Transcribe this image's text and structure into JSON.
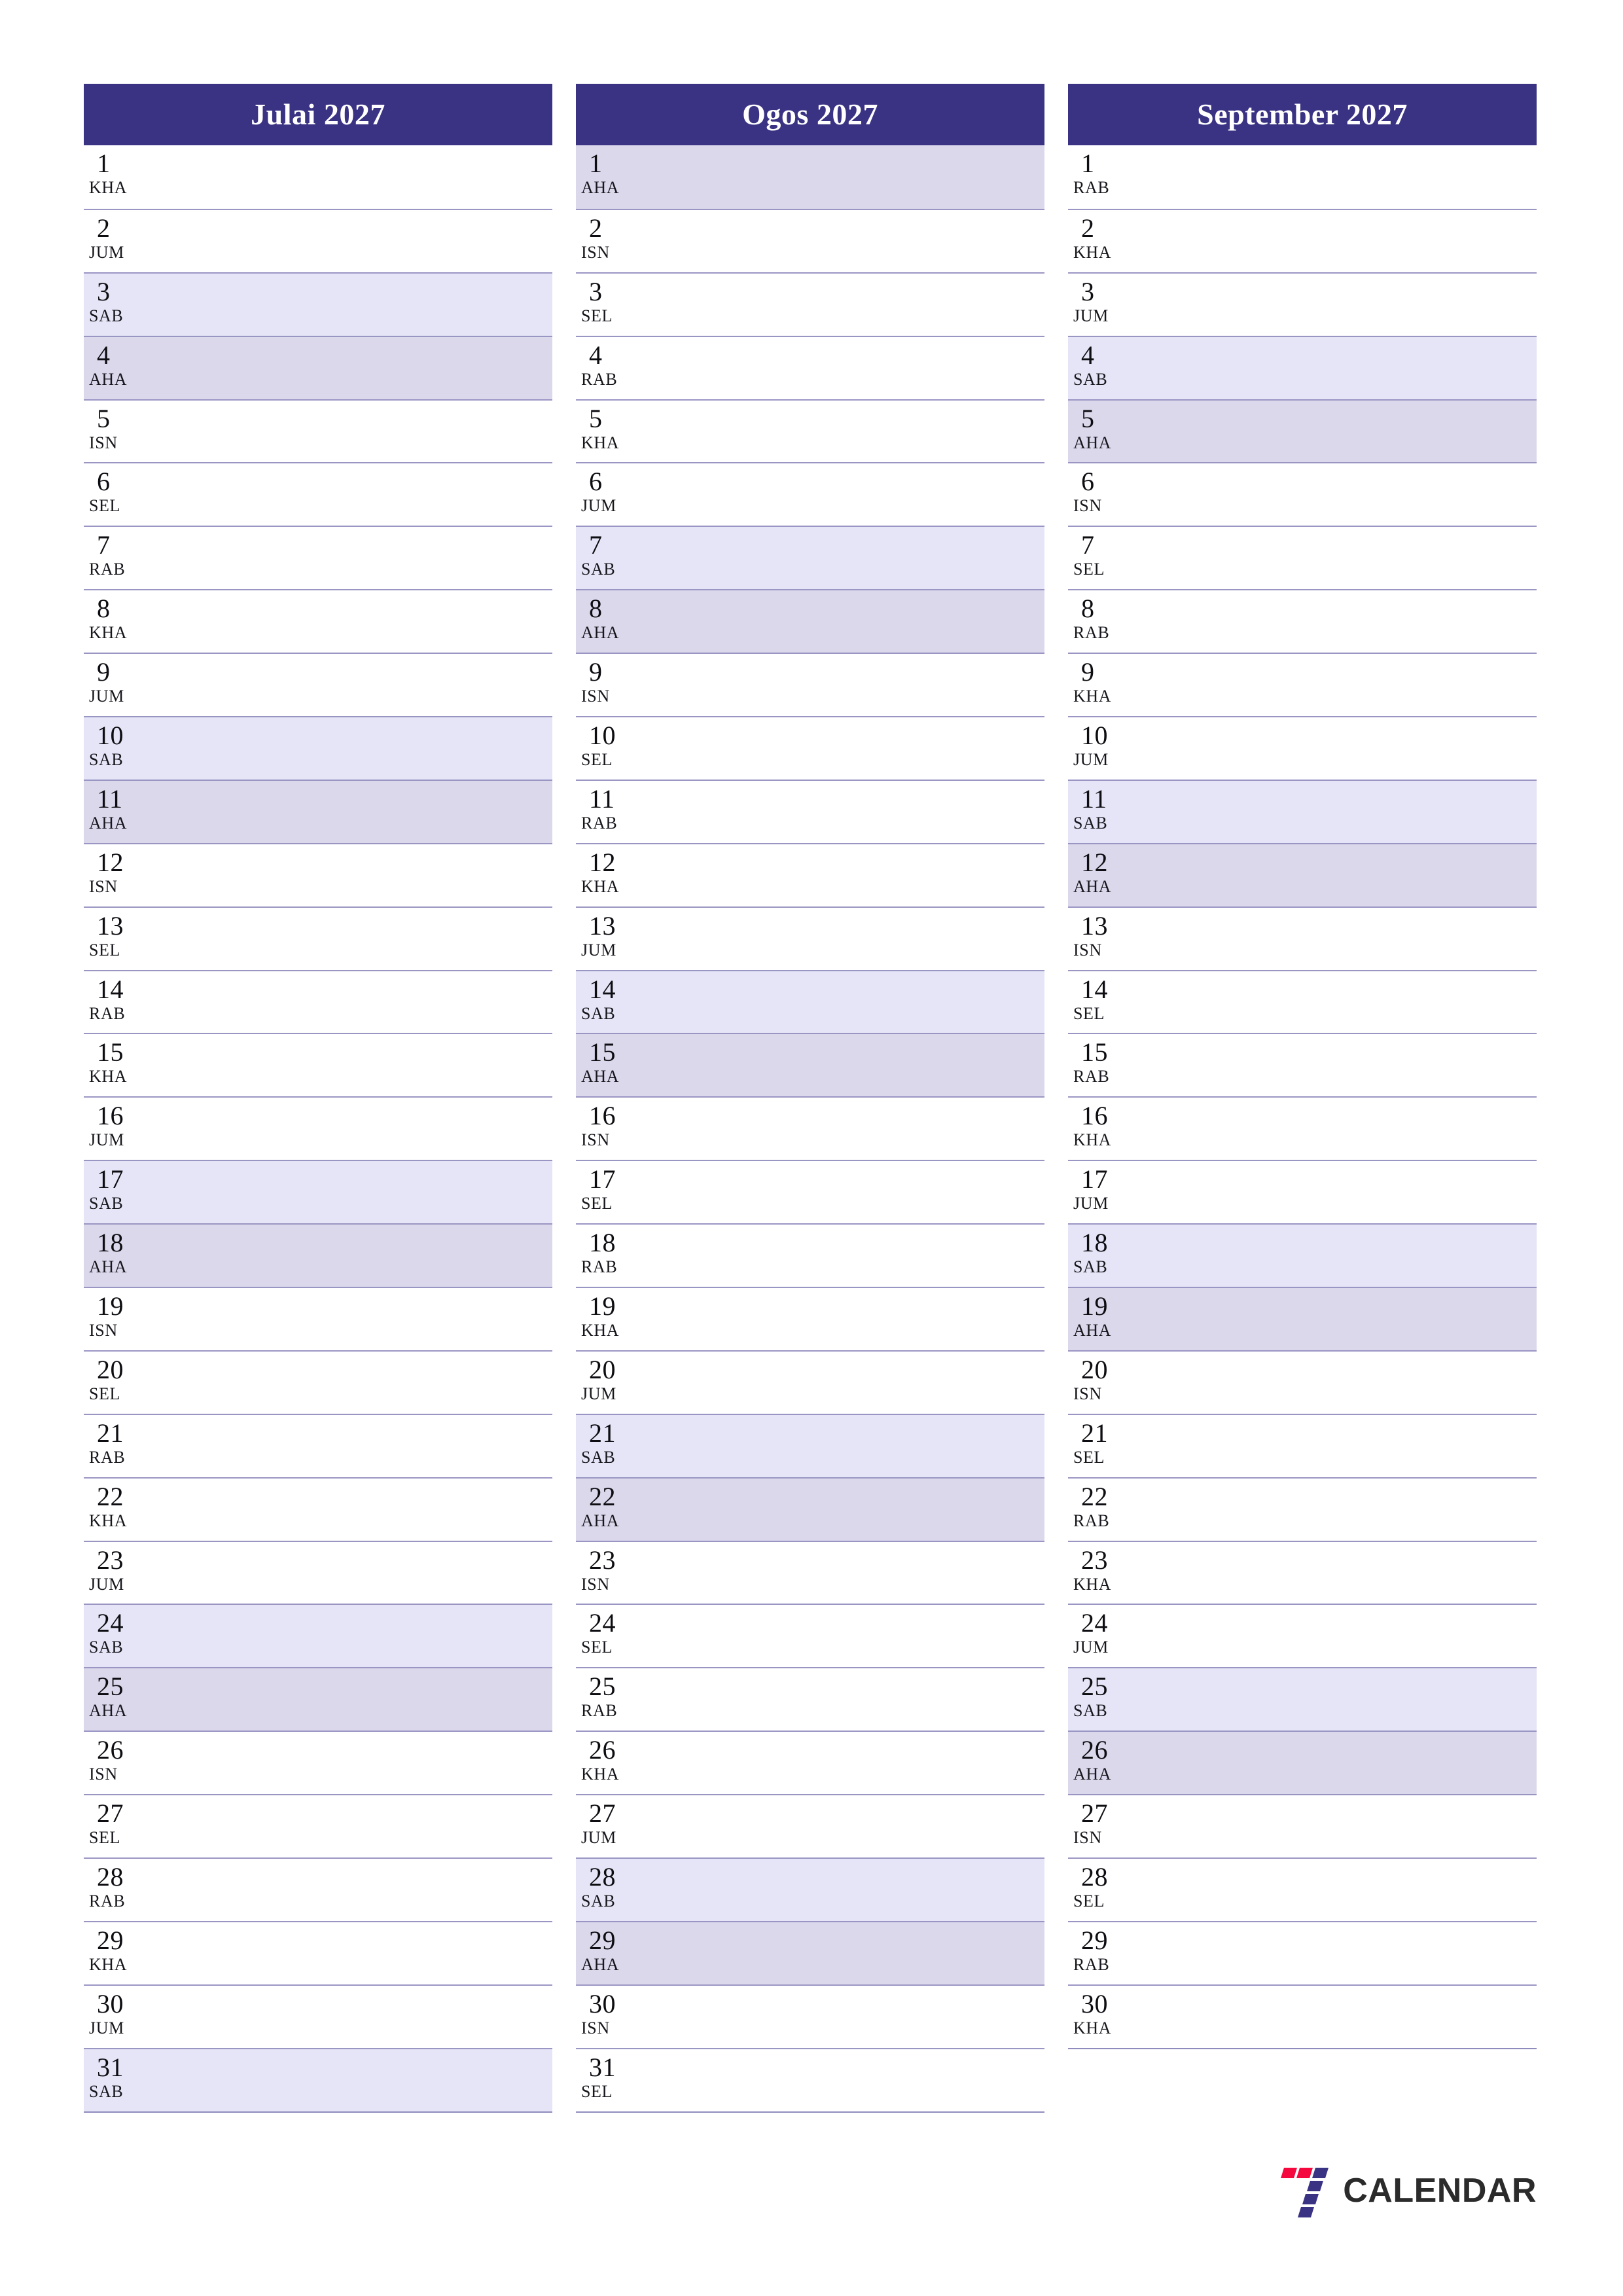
{
  "document": {
    "title": "Julai 2027 - Ogos 2027 - September 2027",
    "language": "Malay",
    "year": "2027"
  },
  "colors": {
    "header_bg": "#3a3383",
    "header_text": "#ffffff",
    "saturday_bg": "#e5e5f7",
    "sunday_bg": "#dcd8ec",
    "row_border": "#9a96c4",
    "text": "#0d0d12",
    "logo_red": "#f5083d",
    "logo_blue": "#3a3383",
    "logo_word": "#2b2b2b"
  },
  "weekday_abbreviations": {
    "monday": "ISN",
    "tuesday": "SEL",
    "wednesday": "RAB",
    "thursday": "KHA",
    "friday": "JUM",
    "saturday": "SAB",
    "sunday": "AHA"
  },
  "months": [
    {
      "title": "Julai 2027",
      "days": [
        {
          "num": "1",
          "name": "KHA",
          "type": "weekday"
        },
        {
          "num": "2",
          "name": "JUM",
          "type": "weekday"
        },
        {
          "num": "3",
          "name": "SAB",
          "type": "sat"
        },
        {
          "num": "4",
          "name": "AHA",
          "type": "sun"
        },
        {
          "num": "5",
          "name": "ISN",
          "type": "weekday"
        },
        {
          "num": "6",
          "name": "SEL",
          "type": "weekday"
        },
        {
          "num": "7",
          "name": "RAB",
          "type": "weekday"
        },
        {
          "num": "8",
          "name": "KHA",
          "type": "weekday"
        },
        {
          "num": "9",
          "name": "JUM",
          "type": "weekday"
        },
        {
          "num": "10",
          "name": "SAB",
          "type": "sat"
        },
        {
          "num": "11",
          "name": "AHA",
          "type": "sun"
        },
        {
          "num": "12",
          "name": "ISN",
          "type": "weekday"
        },
        {
          "num": "13",
          "name": "SEL",
          "type": "weekday"
        },
        {
          "num": "14",
          "name": "RAB",
          "type": "weekday"
        },
        {
          "num": "15",
          "name": "KHA",
          "type": "weekday"
        },
        {
          "num": "16",
          "name": "JUM",
          "type": "weekday"
        },
        {
          "num": "17",
          "name": "SAB",
          "type": "sat"
        },
        {
          "num": "18",
          "name": "AHA",
          "type": "sun"
        },
        {
          "num": "19",
          "name": "ISN",
          "type": "weekday"
        },
        {
          "num": "20",
          "name": "SEL",
          "type": "weekday"
        },
        {
          "num": "21",
          "name": "RAB",
          "type": "weekday"
        },
        {
          "num": "22",
          "name": "KHA",
          "type": "weekday"
        },
        {
          "num": "23",
          "name": "JUM",
          "type": "weekday"
        },
        {
          "num": "24",
          "name": "SAB",
          "type": "sat"
        },
        {
          "num": "25",
          "name": "AHA",
          "type": "sun"
        },
        {
          "num": "26",
          "name": "ISN",
          "type": "weekday"
        },
        {
          "num": "27",
          "name": "SEL",
          "type": "weekday"
        },
        {
          "num": "28",
          "name": "RAB",
          "type": "weekday"
        },
        {
          "num": "29",
          "name": "KHA",
          "type": "weekday"
        },
        {
          "num": "30",
          "name": "JUM",
          "type": "weekday"
        },
        {
          "num": "31",
          "name": "SAB",
          "type": "sat"
        }
      ]
    },
    {
      "title": "Ogos 2027",
      "days": [
        {
          "num": "1",
          "name": "AHA",
          "type": "sun"
        },
        {
          "num": "2",
          "name": "ISN",
          "type": "weekday"
        },
        {
          "num": "3",
          "name": "SEL",
          "type": "weekday"
        },
        {
          "num": "4",
          "name": "RAB",
          "type": "weekday"
        },
        {
          "num": "5",
          "name": "KHA",
          "type": "weekday"
        },
        {
          "num": "6",
          "name": "JUM",
          "type": "weekday"
        },
        {
          "num": "7",
          "name": "SAB",
          "type": "sat"
        },
        {
          "num": "8",
          "name": "AHA",
          "type": "sun"
        },
        {
          "num": "9",
          "name": "ISN",
          "type": "weekday"
        },
        {
          "num": "10",
          "name": "SEL",
          "type": "weekday"
        },
        {
          "num": "11",
          "name": "RAB",
          "type": "weekday"
        },
        {
          "num": "12",
          "name": "KHA",
          "type": "weekday"
        },
        {
          "num": "13",
          "name": "JUM",
          "type": "weekday"
        },
        {
          "num": "14",
          "name": "SAB",
          "type": "sat"
        },
        {
          "num": "15",
          "name": "AHA",
          "type": "sun"
        },
        {
          "num": "16",
          "name": "ISN",
          "type": "weekday"
        },
        {
          "num": "17",
          "name": "SEL",
          "type": "weekday"
        },
        {
          "num": "18",
          "name": "RAB",
          "type": "weekday"
        },
        {
          "num": "19",
          "name": "KHA",
          "type": "weekday"
        },
        {
          "num": "20",
          "name": "JUM",
          "type": "weekday"
        },
        {
          "num": "21",
          "name": "SAB",
          "type": "sat"
        },
        {
          "num": "22",
          "name": "AHA",
          "type": "sun"
        },
        {
          "num": "23",
          "name": "ISN",
          "type": "weekday"
        },
        {
          "num": "24",
          "name": "SEL",
          "type": "weekday"
        },
        {
          "num": "25",
          "name": "RAB",
          "type": "weekday"
        },
        {
          "num": "26",
          "name": "KHA",
          "type": "weekday"
        },
        {
          "num": "27",
          "name": "JUM",
          "type": "weekday"
        },
        {
          "num": "28",
          "name": "SAB",
          "type": "sat"
        },
        {
          "num": "29",
          "name": "AHA",
          "type": "sun"
        },
        {
          "num": "30",
          "name": "ISN",
          "type": "weekday"
        },
        {
          "num": "31",
          "name": "SEL",
          "type": "weekday"
        }
      ]
    },
    {
      "title": "September 2027",
      "days": [
        {
          "num": "1",
          "name": "RAB",
          "type": "weekday"
        },
        {
          "num": "2",
          "name": "KHA",
          "type": "weekday"
        },
        {
          "num": "3",
          "name": "JUM",
          "type": "weekday"
        },
        {
          "num": "4",
          "name": "SAB",
          "type": "sat"
        },
        {
          "num": "5",
          "name": "AHA",
          "type": "sun"
        },
        {
          "num": "6",
          "name": "ISN",
          "type": "weekday"
        },
        {
          "num": "7",
          "name": "SEL",
          "type": "weekday"
        },
        {
          "num": "8",
          "name": "RAB",
          "type": "weekday"
        },
        {
          "num": "9",
          "name": "KHA",
          "type": "weekday"
        },
        {
          "num": "10",
          "name": "JUM",
          "type": "weekday"
        },
        {
          "num": "11",
          "name": "SAB",
          "type": "sat"
        },
        {
          "num": "12",
          "name": "AHA",
          "type": "sun"
        },
        {
          "num": "13",
          "name": "ISN",
          "type": "weekday"
        },
        {
          "num": "14",
          "name": "SEL",
          "type": "weekday"
        },
        {
          "num": "15",
          "name": "RAB",
          "type": "weekday"
        },
        {
          "num": "16",
          "name": "KHA",
          "type": "weekday"
        },
        {
          "num": "17",
          "name": "JUM",
          "type": "weekday"
        },
        {
          "num": "18",
          "name": "SAB",
          "type": "sat"
        },
        {
          "num": "19",
          "name": "AHA",
          "type": "sun"
        },
        {
          "num": "20",
          "name": "ISN",
          "type": "weekday"
        },
        {
          "num": "21",
          "name": "SEL",
          "type": "weekday"
        },
        {
          "num": "22",
          "name": "RAB",
          "type": "weekday"
        },
        {
          "num": "23",
          "name": "KHA",
          "type": "weekday"
        },
        {
          "num": "24",
          "name": "JUM",
          "type": "weekday"
        },
        {
          "num": "25",
          "name": "SAB",
          "type": "sat"
        },
        {
          "num": "26",
          "name": "AHA",
          "type": "sun"
        },
        {
          "num": "27",
          "name": "ISN",
          "type": "weekday"
        },
        {
          "num": "28",
          "name": "SEL",
          "type": "weekday"
        },
        {
          "num": "29",
          "name": "RAB",
          "type": "weekday"
        },
        {
          "num": "30",
          "name": "KHA",
          "type": "weekday"
        }
      ]
    }
  ],
  "footer": {
    "logo_text": "CALENDAR",
    "logo_icon": "seven-logo-icon"
  }
}
